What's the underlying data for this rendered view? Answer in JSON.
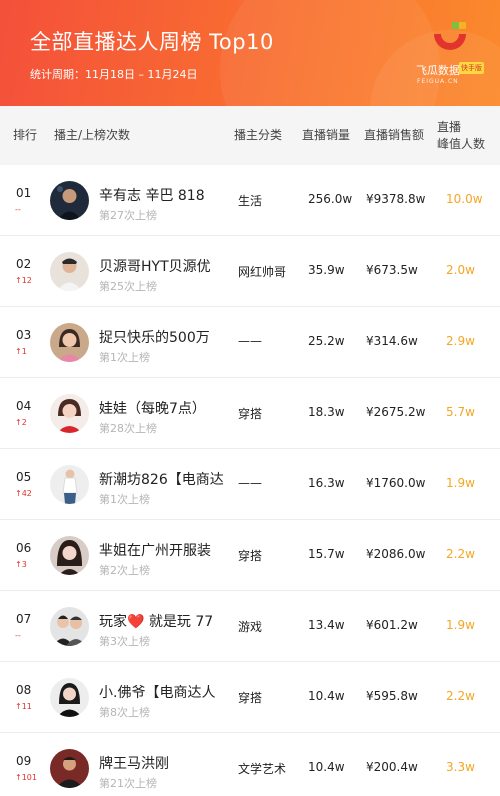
{
  "header": {
    "title": "全部直播达人周榜 Top10",
    "period_label": "统计周期：11月18日 – 11月24日",
    "logo": {
      "name": "飞瓜数据",
      "badge": "快手版",
      "subtitle": "FEIGUA.CN",
      "colors": [
        "#e2332c",
        "#f5b324",
        "#7bc143"
      ]
    }
  },
  "table": {
    "headers": {
      "rank": "排行",
      "anchor": "播主/上榜次数",
      "category": "播主分类",
      "sales": "直播销量",
      "amount": "直播销售额",
      "peak_line1": "直播",
      "peak_line2": "峰值人数"
    },
    "rows": [
      {
        "rank": "01",
        "change": "--",
        "name": "辛有志 辛巴 818",
        "times": "第27次上榜",
        "category": "生活",
        "sales": "256.0w",
        "amount": "¥9378.8w",
        "peak": "10.0w",
        "avatar_icon": "avatar-man-dark"
      },
      {
        "rank": "02",
        "change": "↑12",
        "name": "贝源哥HYT贝源优",
        "times": "第25次上榜",
        "category": "网红帅哥",
        "sales": "35.9w",
        "amount": "¥673.5w",
        "peak": "2.0w",
        "avatar_icon": "avatar-man-light"
      },
      {
        "rank": "03",
        "change": "↑1",
        "name": "捉只快乐的500万",
        "times": "第1次上榜",
        "category": "——",
        "sales": "25.2w",
        "amount": "¥314.6w",
        "peak": "2.9w",
        "avatar_icon": "avatar-woman-pink"
      },
      {
        "rank": "04",
        "change": "↑2",
        "name": "娃娃（每晚7点）",
        "times": "第28次上榜",
        "category": "穿搭",
        "sales": "18.3w",
        "amount": "¥2675.2w",
        "peak": "5.7w",
        "avatar_icon": "avatar-woman-red"
      },
      {
        "rank": "05",
        "change": "↑42",
        "name": "新潮坊826【电商达",
        "times": "第1次上榜",
        "category": "——",
        "sales": "16.3w",
        "amount": "¥1760.0w",
        "peak": "1.9w",
        "avatar_icon": "avatar-woman-standing"
      },
      {
        "rank": "06",
        "change": "↑3",
        "name": "芈姐在广州开服装",
        "times": "第2次上榜",
        "category": "穿搭",
        "sales": "15.7w",
        "amount": "¥2086.0w",
        "peak": "2.2w",
        "avatar_icon": "avatar-woman-dark"
      },
      {
        "rank": "07",
        "change": "--",
        "name": "玩家❤️   就是玩 77",
        "times": "第3次上榜",
        "category": "游戏",
        "sales": "13.4w",
        "amount": "¥601.2w",
        "peak": "1.9w",
        "avatar_icon": "avatar-couple"
      },
      {
        "rank": "08",
        "change": "↑11",
        "name": "小.佛爷【电商达人",
        "times": "第8次上榜",
        "category": "穿搭",
        "sales": "10.4w",
        "amount": "¥595.8w",
        "peak": "2.2w",
        "avatar_icon": "avatar-woman-black"
      },
      {
        "rank": "09",
        "change": "↑101",
        "name": "牌王马洪刚",
        "times": "第21次上榜",
        "category": "文学艺术",
        "sales": "10.4w",
        "amount": "¥200.4w",
        "peak": "3.3w",
        "avatar_icon": "avatar-man-red"
      }
    ]
  }
}
